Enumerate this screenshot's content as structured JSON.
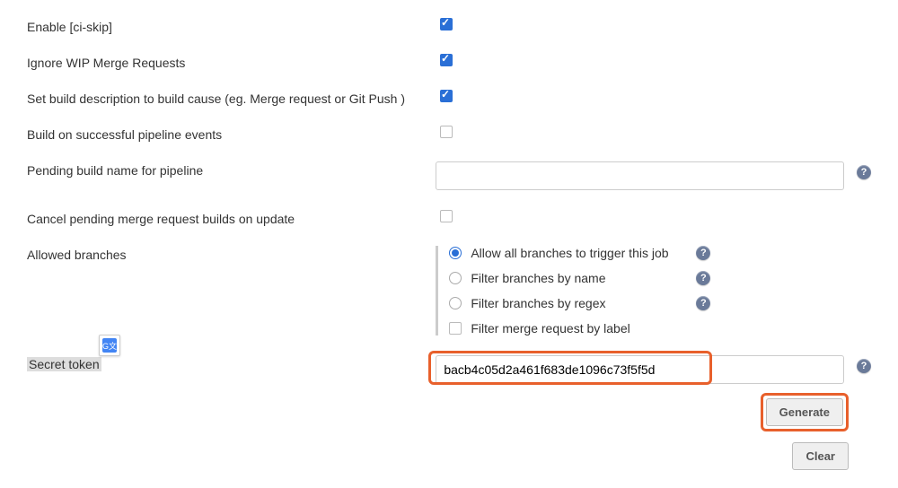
{
  "rows": {
    "ci_skip": {
      "label": "Enable [ci-skip]"
    },
    "ignore_wip": {
      "label": "Ignore WIP Merge Requests"
    },
    "build_desc": {
      "label": "Set build description to build cause (eg. Merge request or Git Push )"
    },
    "build_success": {
      "label": "Build on successful pipeline events"
    },
    "pending_name": {
      "label": "Pending build name for pipeline",
      "value": ""
    },
    "cancel_pending": {
      "label": "Cancel pending merge request builds on update"
    },
    "allowed_branches": {
      "label": "Allowed branches",
      "options": {
        "all": "Allow all branches to trigger this job",
        "by_name": "Filter branches by name",
        "by_regex": "Filter branches by regex",
        "by_label": "Filter merge request by label"
      }
    },
    "secret_token": {
      "label": "Secret token",
      "value": "bacb4c05d2a461f683de1096c73f5f5d"
    }
  },
  "buttons": {
    "generate": "Generate",
    "clear": "Clear"
  },
  "icons": {
    "help": "?",
    "translate": "G⠀"
  }
}
